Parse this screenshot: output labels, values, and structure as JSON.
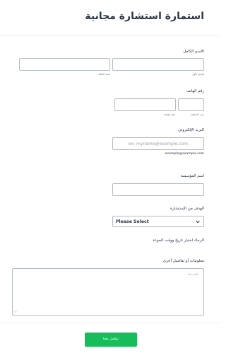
{
  "form": {
    "title": "استمارة استشارة مجانية"
  },
  "full_name": {
    "label": "الاسم الكامل",
    "first_sublabel": "الإسم الأول",
    "last_sublabel": "اسم العائلة",
    "first_value": "",
    "last_value": ""
  },
  "phone": {
    "label": "رقم الهاتف",
    "area_sublabel": "رمز المنطقة",
    "number_sublabel": "رقم الهاتف",
    "area_value": "",
    "number_value": ""
  },
  "email": {
    "label": "البريد الإلكتروني",
    "placeholder": "ex: myname@example.com",
    "hint": "example@example.com",
    "value": ""
  },
  "company": {
    "label": "اسم المؤسسة",
    "value": ""
  },
  "goal": {
    "label": "الهدف من الإستشارة",
    "selected": "Please Select"
  },
  "appointment": {
    "label": "الرجاء اختيار تاريخ ووقت الموعد"
  },
  "notes": {
    "label": "معلومات أو تفاصيل أخرى",
    "placeholder": "اكتب هنا...",
    "value": ""
  },
  "submit": {
    "label": "تواصل معنا"
  },
  "colors": {
    "accent": "#18bd5b",
    "text": "#2c3345",
    "border": "#b7bbc8"
  }
}
